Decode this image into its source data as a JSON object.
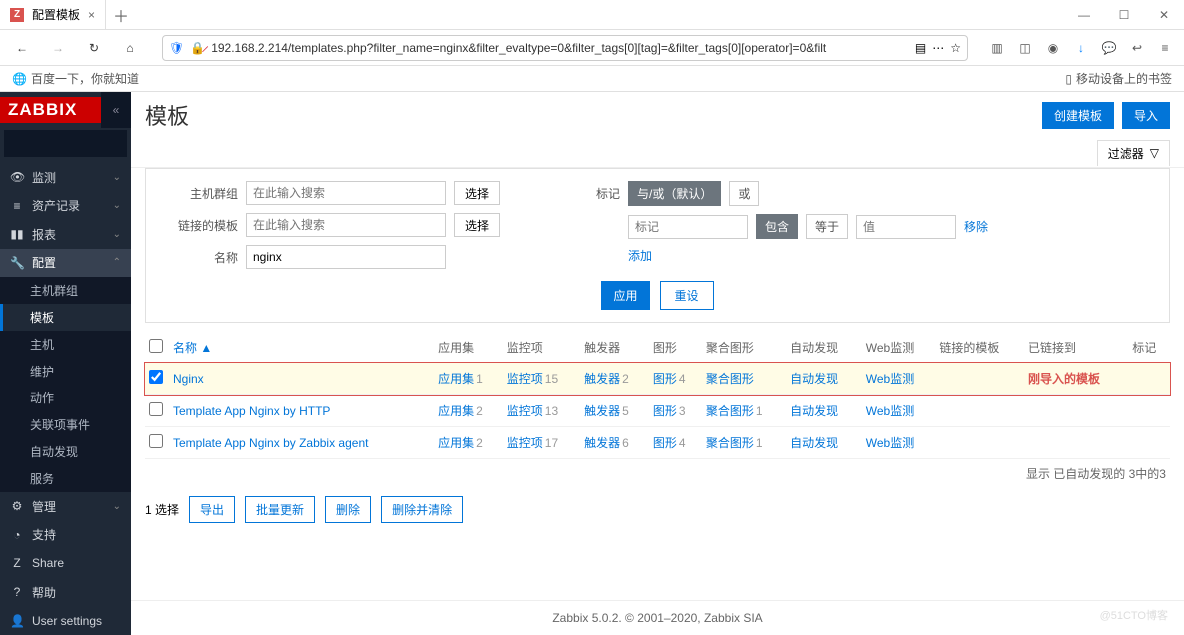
{
  "browser": {
    "tab_title": "配置模板",
    "url": "192.168.2.214/templates.php?filter_name=nginx&filter_evaltype=0&filter_tags[0][tag]=&filter_tags[0][operator]=0&filt",
    "bookmark1": "百度一下，你就知道",
    "bookmark2": "移动设备上的书签"
  },
  "sidebar": {
    "logo": "ZABBIX",
    "search_placeholder": "",
    "items": [
      {
        "label": "监测"
      },
      {
        "label": "资产记录"
      },
      {
        "label": "报表"
      },
      {
        "label": "配置"
      },
      {
        "label": "管理"
      },
      {
        "label": "支持"
      },
      {
        "label": "Share"
      },
      {
        "label": "帮助"
      },
      {
        "label": "User settings"
      }
    ],
    "config_sub": [
      "主机群组",
      "模板",
      "主机",
      "维护",
      "动作",
      "关联项事件",
      "自动发现",
      "服务"
    ]
  },
  "page": {
    "title": "模板",
    "create_btn": "创建模板",
    "import_btn": "导入"
  },
  "filter": {
    "tab": "过滤器",
    "host_group_label": "主机群组",
    "host_group_ph": "在此输入搜索",
    "linked_tpl_label": "链接的模板",
    "linked_tpl_ph": "在此输入搜索",
    "name_label": "名称",
    "name_value": "nginx",
    "select_btn": "选择",
    "tag_label": "标记",
    "and_or": "与/或（默认）",
    "or": "或",
    "tag_ph": "标记",
    "contains": "包含",
    "equals": "等于",
    "value_ph": "值",
    "remove": "移除",
    "add": "添加",
    "apply": "应用",
    "reset": "重设"
  },
  "table": {
    "headers": {
      "name": "名称",
      "apps": "应用集",
      "items": "监控项",
      "triggers": "触发器",
      "graphs": "图形",
      "screens": "聚合图形",
      "discovery": "自动发现",
      "web": "Web监测",
      "linked": "链接的模板",
      "linked_to": "已链接到",
      "tags": "标记"
    },
    "rows": [
      {
        "checked": true,
        "name": "Nginx",
        "apps": "应用集",
        "apps_n": "1",
        "items": "监控项",
        "items_n": "15",
        "triggers": "触发器",
        "triggers_n": "2",
        "graphs": "图形",
        "graphs_n": "4",
        "screens": "聚合图形",
        "screens_n": "",
        "discovery": "自动发现",
        "discovery_n": "",
        "web": "Web监测",
        "annot": "刚导入的模板",
        "highlight": true
      },
      {
        "checked": false,
        "name": "Template App Nginx by HTTP",
        "apps": "应用集",
        "apps_n": "2",
        "items": "监控项",
        "items_n": "13",
        "triggers": "触发器",
        "triggers_n": "5",
        "graphs": "图形",
        "graphs_n": "3",
        "screens": "聚合图形",
        "screens_n": "1",
        "discovery": "自动发现",
        "discovery_n": "",
        "web": "Web监测",
        "annot": "",
        "highlight": false
      },
      {
        "checked": false,
        "name": "Template App Nginx by Zabbix agent",
        "apps": "应用集",
        "apps_n": "2",
        "items": "监控项",
        "items_n": "17",
        "triggers": "触发器",
        "triggers_n": "6",
        "graphs": "图形",
        "graphs_n": "4",
        "screens": "聚合图形",
        "screens_n": "1",
        "discovery": "自动发现",
        "discovery_n": "",
        "web": "Web监测",
        "annot": "",
        "highlight": false
      }
    ],
    "result_info": "显示 已自动发现的 3中的3"
  },
  "actions": {
    "selected": "1 选择",
    "export": "导出",
    "bulk_update": "批量更新",
    "delete": "删除",
    "delete_clear": "删除并清除"
  },
  "footer": "Zabbix 5.0.2. © 2001–2020, Zabbix SIA",
  "watermark": "@51CTO博客"
}
